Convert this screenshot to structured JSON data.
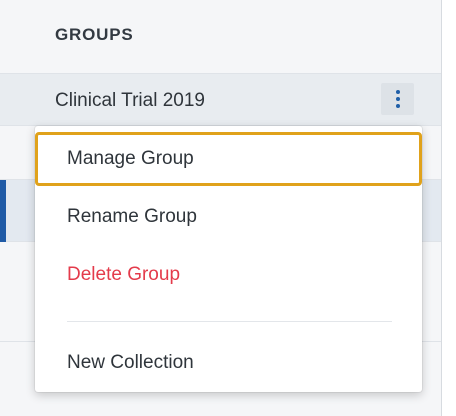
{
  "groups_panel": {
    "header": "GROUPS",
    "current_group": "Clinical Trial 2019"
  },
  "context_menu": {
    "items": [
      {
        "label": "Manage Group",
        "state": "focused"
      },
      {
        "label": "Rename Group",
        "state": "normal"
      },
      {
        "label": "Delete Group",
        "state": "danger"
      },
      {
        "label": "New Collection",
        "state": "normal"
      }
    ]
  },
  "icons": {
    "group_options": "more-vertical-icon"
  },
  "colors": {
    "accent": "#1f5aa6",
    "focus_ring": "#e0a21b",
    "danger": "#e43b4b",
    "panel_bg": "#f5f6f8"
  }
}
